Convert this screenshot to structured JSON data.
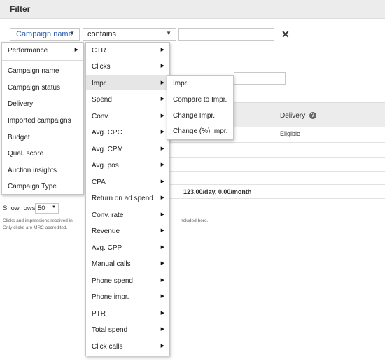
{
  "header": {
    "title": "Filter"
  },
  "filter_row": {
    "field_label": "Campaign name",
    "operator_label": "contains",
    "value": "",
    "close_glyph": "✕"
  },
  "table": {
    "delivery_header": "Delivery",
    "help_glyph": "?",
    "status_value": "Eligible",
    "budget_value": "123.00/day, 0.00/month"
  },
  "show_rows": {
    "label": "Show rows:",
    "value": "50"
  },
  "footnotes": [
    "Clicks and impressions received in",
    "Only clicks are MRC accredited."
  ],
  "footnote_tail": "ncluded here.",
  "menu_primary": [
    {
      "label": "Performance",
      "has_submenu": true
    },
    {
      "label": "Campaign name"
    },
    {
      "label": "Campaign status"
    },
    {
      "label": "Delivery"
    },
    {
      "label": "Imported campaigns"
    },
    {
      "label": "Budget"
    },
    {
      "label": "Qual. score"
    },
    {
      "label": "Auction insights"
    },
    {
      "label": "Campaign Type"
    }
  ],
  "menu_metrics": [
    "CTR",
    "Clicks",
    "Impr.",
    "Spend",
    "Conv.",
    "Avg. CPC",
    "Avg. CPM",
    "Avg. pos.",
    "CPA",
    "Return on ad spend",
    "Conv. rate",
    "Revenue",
    "Avg. CPP",
    "Manual calls",
    "Phone spend",
    "Phone impr.",
    "PTR",
    "Total spend",
    "Click calls"
  ],
  "menu_metrics_highlighted": "Impr.",
  "menu_impr": [
    "Impr.",
    "Compare to Impr.",
    "Change Impr.",
    "Change (%) Impr."
  ],
  "icons": {
    "submenu_arrow": "caret-right-icon",
    "dropdown": "caret-down-icon",
    "close": "close-icon",
    "help": "help-icon"
  }
}
